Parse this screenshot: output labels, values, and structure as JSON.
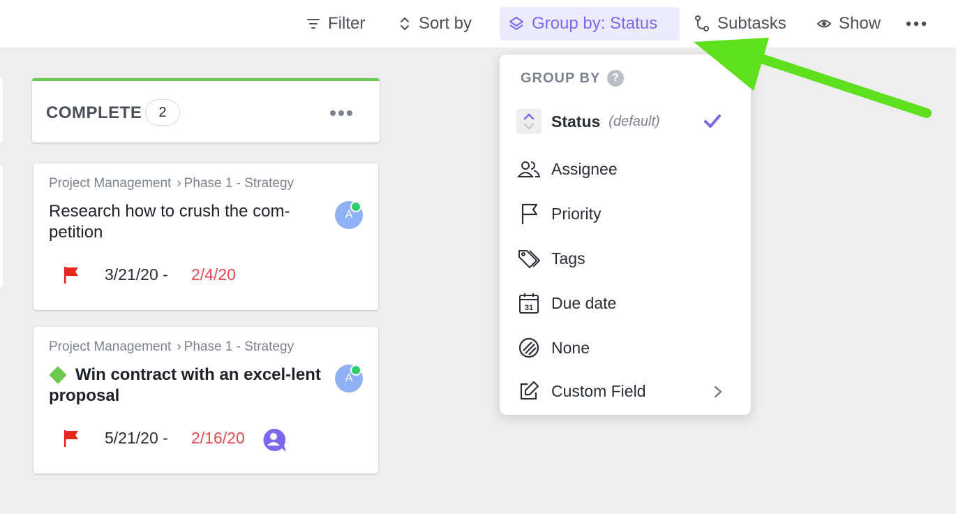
{
  "toolbar": {
    "filter_label": "Filter",
    "sort_label": "Sort by",
    "group_label": "Group by: Status",
    "subtasks_label": "Subtasks",
    "show_label": "Show"
  },
  "column": {
    "title": "COMPLETE",
    "count": "2",
    "accent_color": "#6bc950"
  },
  "cards": [
    {
      "crumb_space": "Project Management",
      "crumb_list": "Phase 1 - Strategy",
      "title": "Research how to crush the com-petition",
      "assignee_initial": "A",
      "priority": "flag-red",
      "start_date": "3/21/20",
      "date_sep": "-",
      "due_date": "2/4/20"
    },
    {
      "crumb_space": "Project Management",
      "crumb_list": "Phase 1 - Strategy",
      "title": "Win contract with an excel-lent proposal",
      "assignee_initial": "A",
      "priority": "flag-red",
      "start_date": "5/21/20",
      "date_sep": "-",
      "due_date": "2/16/20"
    }
  ],
  "group_menu": {
    "heading": "GROUP BY",
    "help_glyph": "?",
    "selected": "Status",
    "items": {
      "status": "Status",
      "status_default": "(default)",
      "assignee": "Assignee",
      "priority": "Priority",
      "tags": "Tags",
      "due_date": "Due date",
      "due_icon_text": "31",
      "none": "None",
      "custom_field": "Custom Field"
    }
  },
  "colors": {
    "accent": "#7b68ee",
    "overdue": "#e5484d",
    "flag": "#e5291f",
    "annotation_arrow": "#5fe01f"
  }
}
